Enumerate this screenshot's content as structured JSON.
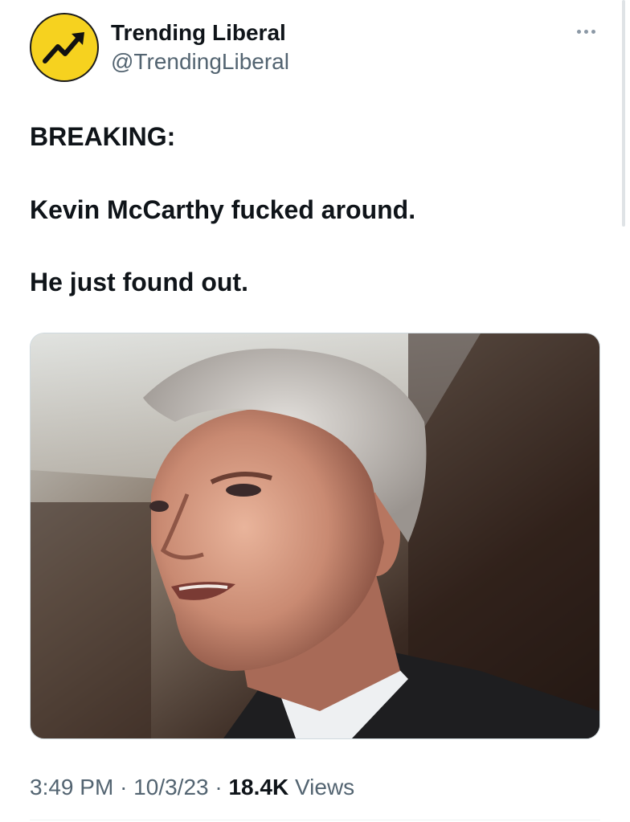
{
  "author": {
    "name": "Trending Liberal",
    "handle": "@TrendingLiberal",
    "avatar_icon": "trending-up-arrow-icon",
    "avatar_color": "#f6d21f"
  },
  "more_icon": "more-horizontal-icon",
  "tweet": {
    "lines": [
      "BREAKING:",
      "Kevin McCarthy fucked around.",
      "He just found out."
    ]
  },
  "media": {
    "type": "photo"
  },
  "meta": {
    "time": "3:49 PM",
    "separator": "·",
    "date": "10/3/23",
    "views_count": "18.4K",
    "views_label": "Views"
  },
  "colors": {
    "text": "#0f1419",
    "secondary": "#536471",
    "divider": "#eff3f4"
  }
}
